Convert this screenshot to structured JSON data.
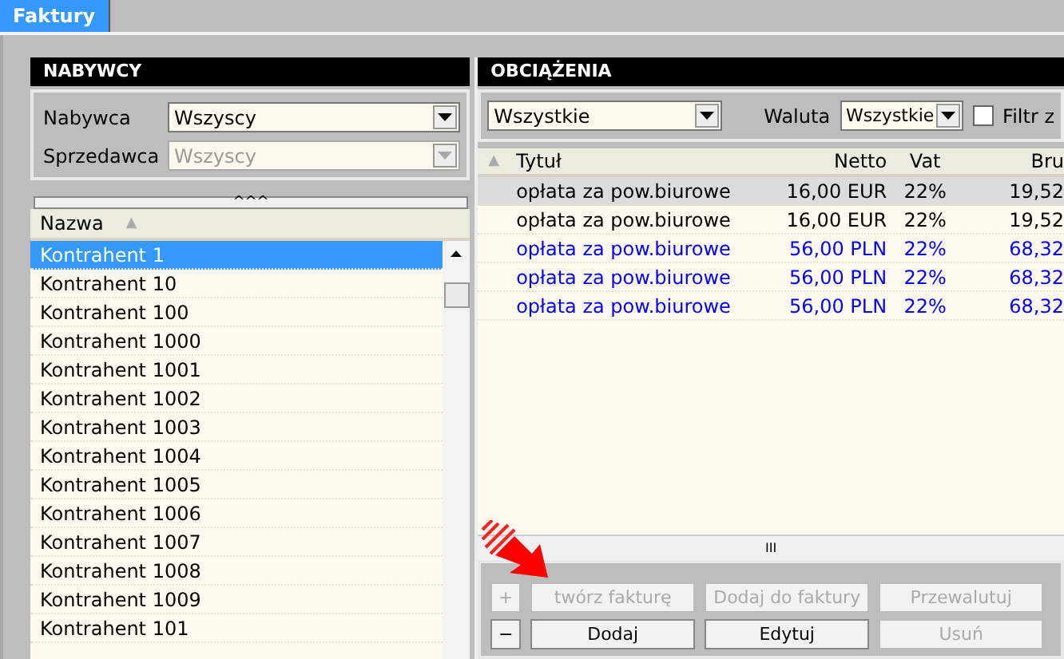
{
  "tabs": [
    {
      "label": "Faktury",
      "selected": true
    }
  ],
  "buyers": {
    "title": "NABYWCY",
    "filters": [
      {
        "label": "Nabywca",
        "value": "Wszyscy",
        "disabled": false
      },
      {
        "label": "Sprzedawca",
        "value": "Wszyscy",
        "disabled": true
      }
    ],
    "collapse": "^^^",
    "list": {
      "column": "Nazwa",
      "sort_icon": "▲",
      "items": [
        {
          "name": "Kontrahent 1",
          "selected": true
        },
        {
          "name": "Kontrahent 10",
          "selected": false
        },
        {
          "name": "Kontrahent 100",
          "selected": false
        },
        {
          "name": "Kontrahent 1000",
          "selected": false
        },
        {
          "name": "Kontrahent 1001",
          "selected": false
        },
        {
          "name": "Kontrahent 1002",
          "selected": false
        },
        {
          "name": "Kontrahent 1003",
          "selected": false
        },
        {
          "name": "Kontrahent 1004",
          "selected": false
        },
        {
          "name": "Kontrahent 1005",
          "selected": false
        },
        {
          "name": "Kontrahent 1006",
          "selected": false
        },
        {
          "name": "Kontrahent 1007",
          "selected": false
        },
        {
          "name": "Kontrahent 1008",
          "selected": false
        },
        {
          "name": "Kontrahent 1009",
          "selected": false
        },
        {
          "name": "Kontrahent 101",
          "selected": false
        }
      ]
    }
  },
  "charges": {
    "title": "OBCIĄŻENIA",
    "type_filter": "Wszystkie",
    "currency_label": "Waluta",
    "currency_filter": "Wszystkie",
    "filter_checkbox": {
      "label": "Filtr z",
      "checked": false
    },
    "table": {
      "sort_icon": "▲",
      "columns": [
        "Tytuł",
        "Netto",
        "Vat",
        "Bru"
      ],
      "rows": [
        {
          "cells": [
            "opłata za pow.biurowe",
            "16,00 EUR",
            "22%",
            "19,52"
          ],
          "selected": true,
          "color": "#000000"
        },
        {
          "cells": [
            "opłata za pow.biurowe",
            "16,00 EUR",
            "22%",
            "19,52"
          ],
          "selected": false,
          "color": "#000000"
        },
        {
          "cells": [
            "opłata za pow.biurowe",
            "56,00 PLN",
            "22%",
            "68,32"
          ],
          "selected": false,
          "color": "#0000ff"
        },
        {
          "cells": [
            "opłata za pow.biurowe",
            "56,00 PLN",
            "22%",
            "68,32"
          ],
          "selected": false,
          "color": "#0000ff"
        },
        {
          "cells": [
            "opłata za pow.biurowe",
            "56,00 PLN",
            "22%",
            "68,32"
          ],
          "selected": false,
          "color": "#0000ff"
        }
      ]
    },
    "scroll_grip": "III",
    "buttons": [
      [
        {
          "label": "+",
          "disabled": true,
          "kind": "small"
        },
        {
          "label": "twórz fakturę",
          "disabled": true,
          "kind": "wide"
        },
        {
          "label": "Dodaj do faktury",
          "disabled": true,
          "kind": "wide"
        },
        {
          "label": "Przewalutuj",
          "disabled": true,
          "kind": "wide"
        }
      ],
      [
        {
          "label": "−",
          "disabled": false,
          "kind": "small"
        },
        {
          "label": "Dodaj",
          "disabled": false,
          "kind": "wide"
        },
        {
          "label": "Edytuj",
          "disabled": false,
          "kind": "wide"
        },
        {
          "label": "Usuń",
          "disabled": true,
          "kind": "wide"
        }
      ]
    ]
  }
}
